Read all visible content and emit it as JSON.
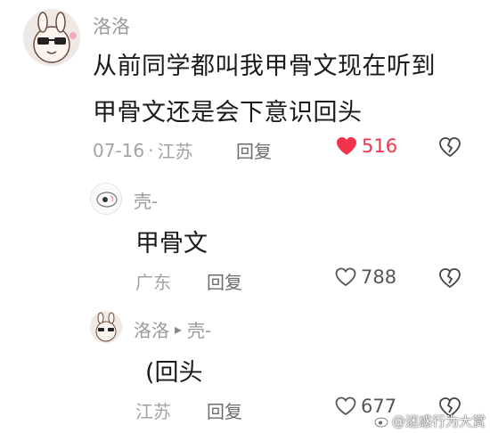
{
  "comment": {
    "username": "洛洛",
    "text_line1": "从前同学都叫我甲骨文现在听到",
    "text_line2": "甲骨文还是会下意识回头",
    "date": "07-16",
    "separator": "·",
    "location": "江苏",
    "reply_label": "回复",
    "likes": "516",
    "liked": true,
    "like_color": "#f0344e"
  },
  "replies": [
    {
      "username": "壳-",
      "text": "甲骨文",
      "location": "广东",
      "reply_label": "回复",
      "likes": "788"
    },
    {
      "username": "洛洛",
      "reply_arrow": "▸",
      "reply_to": "壳-",
      "text": "(回头",
      "location": "江苏",
      "reply_label": "回复",
      "likes": "677"
    }
  ],
  "watermark": {
    "text": "@迷惑行为大赏",
    "icon": "weibo-icon"
  }
}
